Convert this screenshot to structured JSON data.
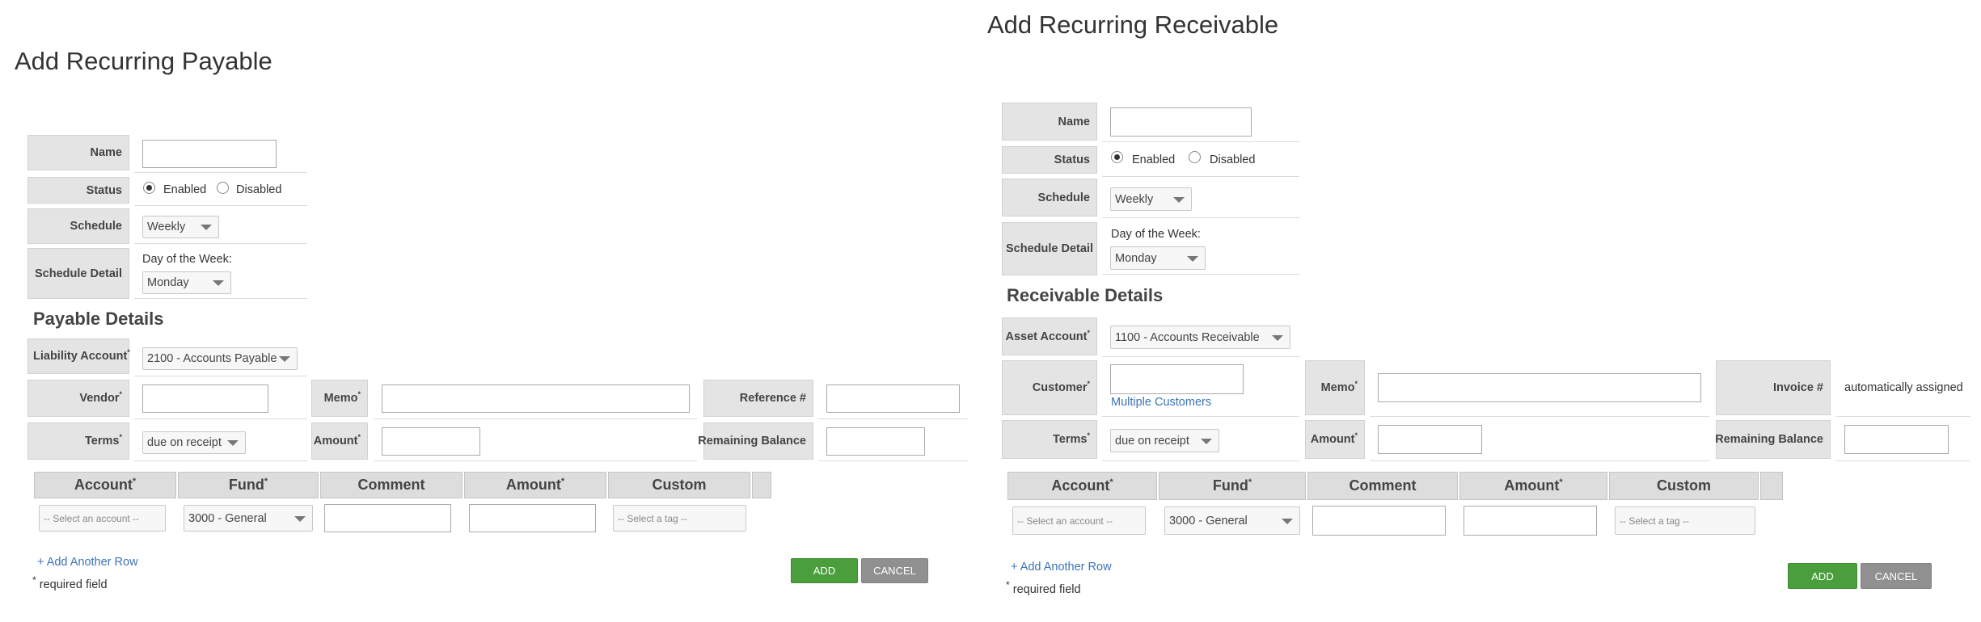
{
  "payable": {
    "title": "Add Recurring Payable",
    "name_label": "Name",
    "status_label": "Status",
    "enabled": "Enabled",
    "disabled": "Disabled",
    "schedule_label": "Schedule",
    "schedule_value": "Weekly",
    "schedule_detail_label": "Schedule Detail",
    "day_of_week_label": "Day of the Week:",
    "day_of_week_value": "Monday",
    "section_title": "Payable Details",
    "account_label": "Liability Account",
    "account_value": "2100 - Accounts Payable",
    "party_label": "Vendor",
    "memo_label": "Memo",
    "ref_label": "Reference #",
    "terms_label": "Terms",
    "terms_value": "due on receipt",
    "amount_label": "Amount",
    "remaining_label": "Remaining Balance",
    "columns": {
      "account": "Account",
      "fund": "Fund",
      "comment": "Comment",
      "amount": "Amount",
      "custom": "Custom"
    },
    "row": {
      "account_placeholder": "-- Select an account --",
      "fund_value": "3000 - General",
      "tag_placeholder": "-- Select a tag --"
    },
    "add_row": "+ Add Another Row",
    "required_note": "required field",
    "add_button": "ADD",
    "cancel_button": "CANCEL"
  },
  "receivable": {
    "title": "Add Recurring Receivable",
    "name_label": "Name",
    "status_label": "Status",
    "enabled": "Enabled",
    "disabled": "Disabled",
    "schedule_label": "Schedule",
    "schedule_value": "Weekly",
    "schedule_detail_label": "Schedule Detail",
    "day_of_week_label": "Day of the Week:",
    "day_of_week_value": "Monday",
    "section_title": "Receivable Details",
    "account_label": "Asset Account",
    "account_value": "1100 - Accounts Receivable",
    "party_label": "Customer",
    "multiple_link": "Multiple Customers",
    "memo_label": "Memo",
    "invoice_label": "Invoice #",
    "invoice_value": "automatically assigned",
    "terms_label": "Terms",
    "terms_value": "due on receipt",
    "amount_label": "Amount",
    "remaining_label": "Remaining Balance",
    "columns": {
      "account": "Account",
      "fund": "Fund",
      "comment": "Comment",
      "amount": "Amount",
      "custom": "Custom"
    },
    "row": {
      "account_placeholder": "-- Select an account --",
      "fund_value": "3000 - General",
      "tag_placeholder": "-- Select a tag --"
    },
    "add_row": "+ Add Another Row",
    "required_note": "required field",
    "add_button": "ADD",
    "cancel_button": "CANCEL"
  },
  "required_marker": "*"
}
